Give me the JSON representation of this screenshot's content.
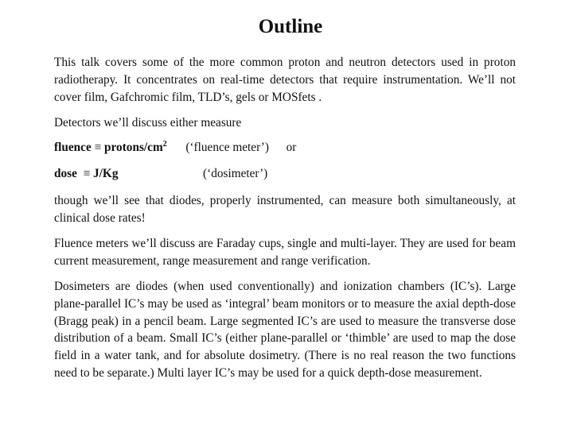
{
  "slide": {
    "title": "Outline",
    "paragraphs": {
      "intro": "This talk covers some of the more common proton and neutron detectors used in proton radiotherapy. It concentrates on real-time detectors that require instrumentation. We’ll not cover film, Gafchromic film, TLD’s, gels or MOSfets .",
      "measure_intro": "Detectors we’ll discuss either measure",
      "diodes": "though we’ll see that diodes, properly instrumented, can measure both simultaneously, at clinical dose rates!",
      "fluence_meters": "Fluence meters we’ll discuss are Faraday cups, single and multi-layer. They are used for beam current measurement, range measurement and range verification.",
      "dosimeters": "Dosimeters are diodes (when used conventionally) and ionization chambers (IC’s). Large plane-parallel IC’s may be used as ‘integral’ beam monitors or to measure the axial depth-dose (Bragg peak) in a pencil beam. Large segmented IC’s are used to measure the transverse dose distribution of a beam. Small IC’s (either plane-parallel or ‘thimble’ are used to map the dose field in a water tank, and for absolute dosimetry. (There is no real reason the two functions need to be separate.) Multi layer IC’s may be used for a quick depth-dose measurement."
    },
    "definitions": {
      "fluence": {
        "term": "fluence",
        "equiv": "≡",
        "unit": "protons/cm",
        "unit_sup": "2",
        "note": "(‘fluence meter’)",
        "connector": "or"
      },
      "dose": {
        "term": "dose",
        "equiv": "≡",
        "unit": "J/Kg",
        "note": "(‘dosimeter’)"
      }
    }
  }
}
